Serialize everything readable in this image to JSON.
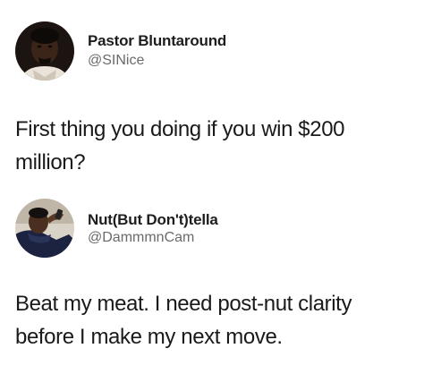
{
  "tweets": [
    {
      "display_name": "Pastor Bluntaround",
      "handle": "@SINice",
      "text": "First thing you doing if you win $200\nmillion?",
      "avatar_icon": "profile-photo-man"
    },
    {
      "display_name": "Nut(But Don't)tella",
      "handle": "@DammmnCam",
      "text": "Beat my meat. I need post-nut clarity\nbefore I make my next move.",
      "avatar_icon": "profile-photo-man-on-phone"
    }
  ]
}
